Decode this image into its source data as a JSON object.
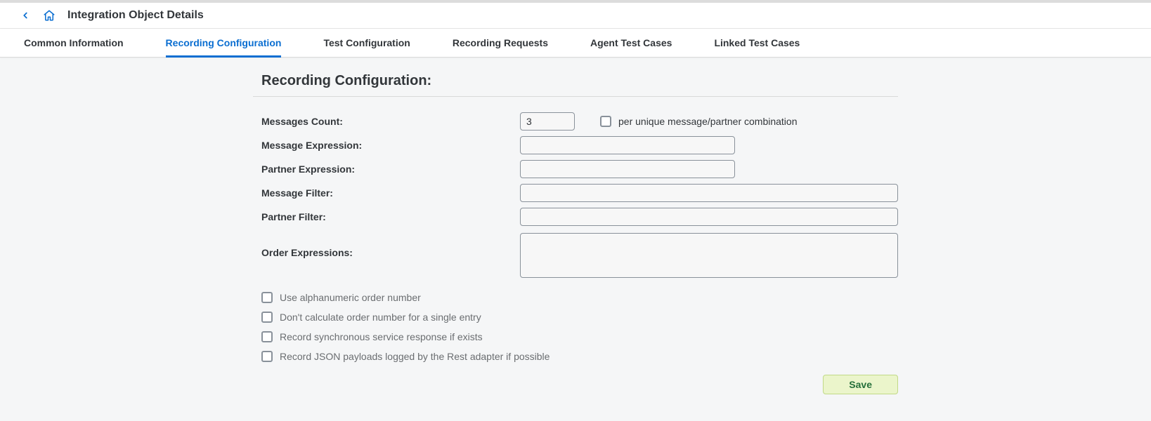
{
  "header": {
    "title": "Integration Object Details"
  },
  "tabs": {
    "items": [
      {
        "label": "Common Information"
      },
      {
        "label": "Recording Configuration"
      },
      {
        "label": "Test Configuration"
      },
      {
        "label": "Recording Requests"
      },
      {
        "label": "Agent Test Cases"
      },
      {
        "label": "Linked Test Cases"
      }
    ],
    "active_index": 1
  },
  "section": {
    "title": "Recording Configuration:"
  },
  "form": {
    "messages_count_label": "Messages Count:",
    "messages_count_value": "3",
    "per_unique_label": "per unique message/partner combination",
    "message_expression_label": "Message Expression:",
    "message_expression_value": "",
    "partner_expression_label": "Partner Expression:",
    "partner_expression_value": "",
    "message_filter_label": "Message Filter:",
    "message_filter_value": "",
    "partner_filter_label": "Partner Filter:",
    "partner_filter_value": "",
    "order_expressions_label": "Order Expressions:",
    "order_expressions_value": "",
    "checkboxes": [
      "Use alphanumeric order number",
      "Don't calculate order number for a single entry",
      "Record synchronous service response if exists",
      "Record JSON payloads logged by the Rest adapter if possible"
    ]
  },
  "buttons": {
    "save": "Save"
  }
}
